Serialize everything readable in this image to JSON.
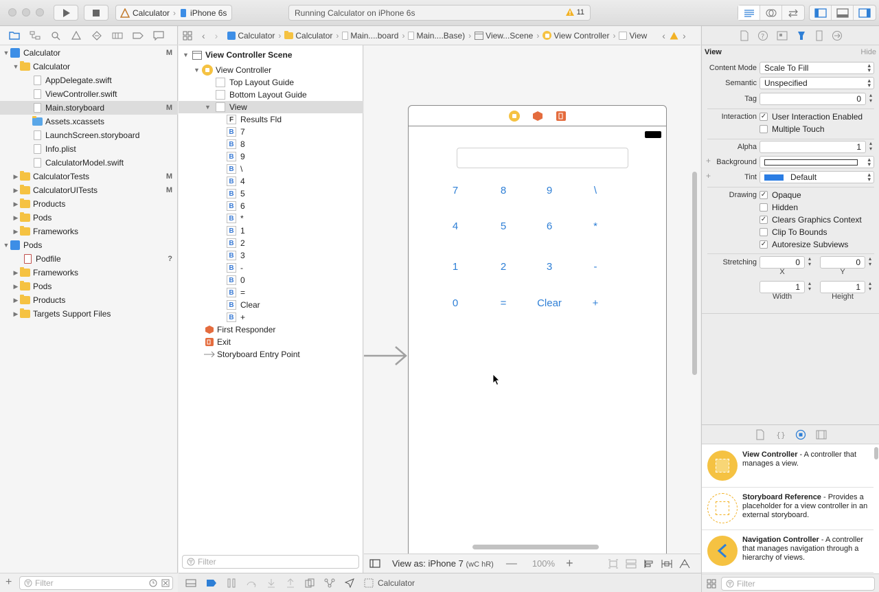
{
  "toolbar": {
    "scheme_target": "Calculator",
    "scheme_device": "iPhone 6s",
    "activity_status": "Running Calculator on iPhone 6s",
    "warning_count": "11"
  },
  "navigator": {
    "items": [
      {
        "label": "Calculator",
        "badge": "M"
      },
      {
        "label": "Calculator",
        "badge": ""
      },
      {
        "label": "AppDelegate.swift",
        "badge": ""
      },
      {
        "label": "ViewController.swift",
        "badge": ""
      },
      {
        "label": "Main.storyboard",
        "badge": "M"
      },
      {
        "label": "Assets.xcassets",
        "badge": ""
      },
      {
        "label": "LaunchScreen.storyboard",
        "badge": ""
      },
      {
        "label": "Info.plist",
        "badge": ""
      },
      {
        "label": "CalculatorModel.swift",
        "badge": ""
      },
      {
        "label": "CalculatorTests",
        "badge": "M"
      },
      {
        "label": "CalculatorUITests",
        "badge": "M"
      },
      {
        "label": "Products",
        "badge": ""
      },
      {
        "label": "Pods",
        "badge": ""
      },
      {
        "label": "Frameworks",
        "badge": ""
      },
      {
        "label": "Pods",
        "badge": ""
      },
      {
        "label": "Podfile",
        "badge": "?"
      },
      {
        "label": "Frameworks",
        "badge": ""
      },
      {
        "label": "Pods",
        "badge": ""
      },
      {
        "label": "Products",
        "badge": ""
      },
      {
        "label": "Targets Support Files",
        "badge": ""
      }
    ],
    "filter_placeholder": "Filter"
  },
  "jumpbar": {
    "crumbs": [
      "Calculator",
      "Calculator",
      "Main....board",
      "Main....Base)",
      "View...Scene",
      "View Controller",
      "View"
    ]
  },
  "outline": {
    "scene": "View Controller Scene",
    "view_controller": "View Controller",
    "top_layout_guide": "Top Layout Guide",
    "bottom_layout_guide": "Bottom Layout Guide",
    "view": "View",
    "results_field": "Results Fld",
    "results_prefix": "F",
    "button_prefix": "B",
    "buttons": [
      "7",
      "8",
      "9",
      "\\",
      "4",
      "5",
      "6",
      "*",
      "1",
      "2",
      "3",
      "-",
      "0",
      "=",
      "Clear",
      "+"
    ],
    "first_responder": "First Responder",
    "exit": "Exit",
    "entry_point": "Storyboard Entry Point",
    "filter_placeholder": "Filter"
  },
  "calculator": {
    "rows": [
      [
        "7",
        "8",
        "9",
        "\\"
      ],
      [
        "4",
        "5",
        "6",
        "*"
      ],
      [
        "1",
        "2",
        "3",
        "-"
      ],
      [
        "0",
        "=",
        "Clear",
        "+"
      ]
    ]
  },
  "canvas_bottom": {
    "view_as": "View as: iPhone 7",
    "size_class": "(wC hR)",
    "zoom": "100%"
  },
  "inspector": {
    "section": "View",
    "hide": "Hide",
    "content_mode_label": "Content Mode",
    "content_mode": "Scale To Fill",
    "semantic_label": "Semantic",
    "semantic": "Unspecified",
    "tag_label": "Tag",
    "tag": "0",
    "interaction_label": "Interaction",
    "user_interaction": "User Interaction Enabled",
    "multiple_touch": "Multiple Touch",
    "alpha_label": "Alpha",
    "alpha": "1",
    "background_label": "Background",
    "tint_label": "Tint",
    "tint": "Default",
    "drawing_label": "Drawing",
    "opaque": "Opaque",
    "hidden": "Hidden",
    "clears_graphics": "Clears Graphics Context",
    "clip_bounds": "Clip To Bounds",
    "autoresize": "Autoresize Subviews",
    "stretching_label": "Stretching",
    "stretch_x": "0",
    "stretch_y": "0",
    "stretch_w": "1",
    "stretch_h": "1",
    "x_label": "X",
    "y_label": "Y",
    "width_label": "Width",
    "height_label": "Height"
  },
  "library": {
    "items": [
      {
        "title": "View Controller",
        "desc": " - A controller that manages a view."
      },
      {
        "title": "Storyboard Reference",
        "desc": " - Provides a placeholder for a view controller in an external storyboard."
      },
      {
        "title": "Navigation Controller",
        "desc": " - A controller that manages navigation through a hierarchy of views."
      }
    ],
    "filter_placeholder": "Filter"
  },
  "debug": {
    "target": "Calculator"
  },
  "colors": {
    "accent": "#2e7fd6",
    "folder": "#f5c242",
    "tint_swatch": "#2b7de3"
  }
}
